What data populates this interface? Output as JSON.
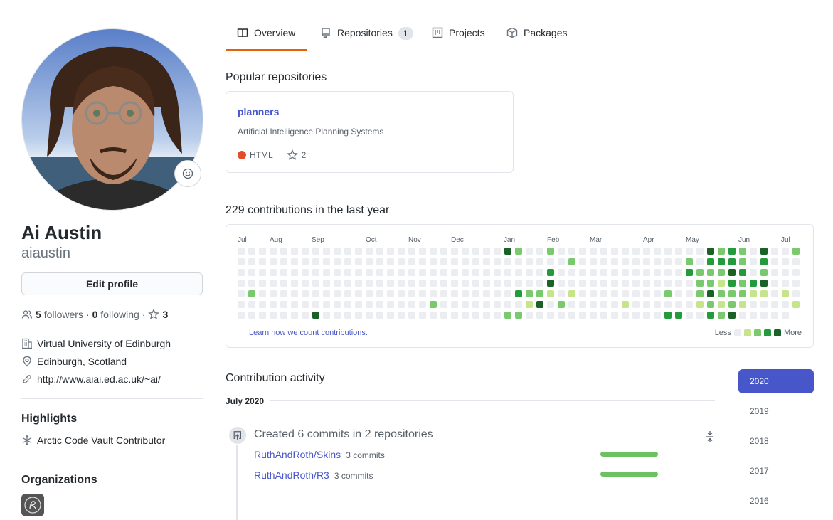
{
  "nav": {
    "tabs": [
      {
        "label": "Overview",
        "icon": "book-icon",
        "active": true
      },
      {
        "label": "Repositories",
        "icon": "repo-icon",
        "count": "1"
      },
      {
        "label": "Projects",
        "icon": "project-icon"
      },
      {
        "label": "Packages",
        "icon": "package-icon"
      }
    ]
  },
  "profile": {
    "fullname": "Ai Austin",
    "username": "aiaustin",
    "edit_label": "Edit profile",
    "followers_count": "5",
    "followers_label": "followers",
    "following_count": "0",
    "following_label": "following",
    "stars_count": "3",
    "company": "Virtual University of Edinburgh",
    "location": "Edinburgh, Scotland",
    "website": "http://www.aiai.ed.ac.uk/~ai/"
  },
  "highlights": {
    "title": "Highlights",
    "items": [
      "Arctic Code Vault Contributor"
    ]
  },
  "organizations": {
    "title": "Organizations"
  },
  "popular": {
    "title": "Popular repositories",
    "repos": [
      {
        "name": "planners",
        "description": "Artificial Intelligence Planning Systems",
        "language": "HTML",
        "language_color": "#e34c26",
        "stars": "2"
      }
    ]
  },
  "contributions": {
    "title": "229 contributions in the last year",
    "months": [
      "Jul",
      "Aug",
      "Sep",
      "Oct",
      "Nov",
      "Dec",
      "Jan",
      "Feb",
      "Mar",
      "Apr",
      "May",
      "Jun",
      "Jul"
    ],
    "learn_link": "Learn how we count contributions.",
    "legend_less": "Less",
    "legend_more": "More",
    "colors": [
      "#ebedf0",
      "#c6e48b",
      "#7bc96f",
      "#239a3b",
      "#196127"
    ]
  },
  "activity": {
    "title": "Contribution activity",
    "month": "July 2020",
    "summary": "Created 6 commits in 2 repositories",
    "repos": [
      {
        "name": "RuthAndRoth/Skins",
        "commits": "3 commits"
      },
      {
        "name": "RuthAndRoth/R3",
        "commits": "3 commits"
      }
    ],
    "years": [
      "2020",
      "2019",
      "2018",
      "2017",
      "2016"
    ],
    "selected_year": "2020"
  }
}
